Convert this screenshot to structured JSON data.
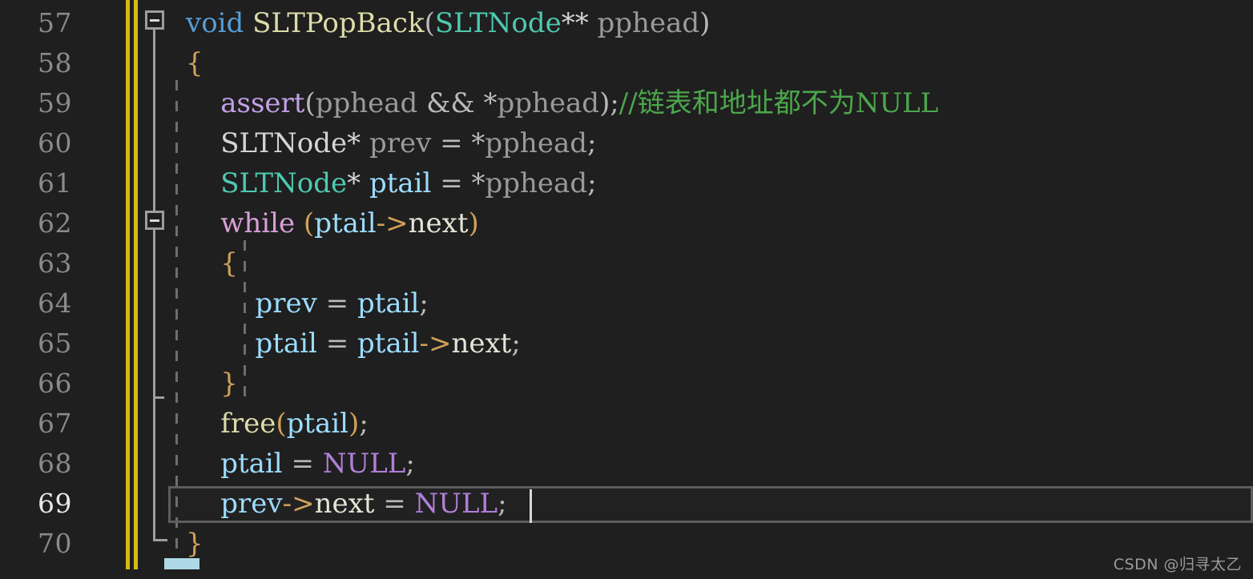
{
  "editor": {
    "background_color": "#1f1f1f",
    "current_line_number": 69,
    "change_bar_color": "#d6b915",
    "fold_guide_color": "#9d9d9d",
    "indent_guide_color": "#6e6e6e",
    "current_line_border_color": "#5d5d5d",
    "caret_color": "#d8d8d8",
    "bottom_marker_color": "#aed8e6",
    "language": "C"
  },
  "colors": {
    "keyword": "#569cd6",
    "control": "#d8a0d8",
    "function": "#dcdcaa",
    "type": "#4ec9b0",
    "variable": "#9cdcfe",
    "parameter": "#9a9a9a",
    "macro": "#c2a0e8",
    "constant": "#b07fd8",
    "punctuation": "#b9b9b9",
    "brace": "#d1a05a",
    "member": "#e4e4d6",
    "comment": "#4ca64c",
    "line_number": "#8a8a8a",
    "line_number_active": "#e8e8e8"
  },
  "gutter": {
    "line_numbers": [
      "57",
      "58",
      "59",
      "60",
      "61",
      "62",
      "63",
      "64",
      "65",
      "66",
      "67",
      "68",
      "69",
      "70"
    ]
  },
  "fold_widgets": [
    {
      "name": "fold-toggle-line-57",
      "line": "57",
      "state": "expanded",
      "glyph": "minus"
    },
    {
      "name": "fold-toggle-line-62",
      "line": "62",
      "state": "expanded",
      "glyph": "minus"
    }
  ],
  "code_lines": [
    {
      "number": "57",
      "plain": "void SLTPopBack(SLTNode** pphead)",
      "tokens": [
        {
          "text": "void",
          "cls": "t-kw"
        },
        {
          "text": " ",
          "cls": "t-punct"
        },
        {
          "text": "SLTPopBack",
          "cls": "t-fn"
        },
        {
          "text": "(",
          "cls": "t-punct"
        },
        {
          "text": "SLTNode",
          "cls": "t-type"
        },
        {
          "text": "**",
          "cls": "t-typep"
        },
        {
          "text": " ",
          "cls": "t-punct"
        },
        {
          "text": "pphead",
          "cls": "t-param"
        },
        {
          "text": ")",
          "cls": "t-punct"
        }
      ]
    },
    {
      "number": "58",
      "plain": "{",
      "tokens": [
        {
          "text": "{",
          "cls": "t-brace"
        }
      ]
    },
    {
      "number": "59",
      "plain": "    assert(pphead && *pphead);//链表和地址都不为NULL",
      "tokens": [
        {
          "text": "    ",
          "cls": "t-punct"
        },
        {
          "text": "assert",
          "cls": "t-macro"
        },
        {
          "text": "(",
          "cls": "t-punct"
        },
        {
          "text": "pphead",
          "cls": "t-param"
        },
        {
          "text": " && *",
          "cls": "t-punct"
        },
        {
          "text": "pphead",
          "cls": "t-param"
        },
        {
          "text": ");",
          "cls": "t-punct"
        },
        {
          "text": "//链表和地址都不为NULL",
          "cls": "t-comment"
        }
      ]
    },
    {
      "number": "60",
      "plain": "    SLTNode* prev = *pphead;",
      "tokens": [
        {
          "text": "    ",
          "cls": "t-punct"
        },
        {
          "text": "SLTNode",
          "cls": "t-typep"
        },
        {
          "text": "*",
          "cls": "t-typep"
        },
        {
          "text": " ",
          "cls": "t-punct"
        },
        {
          "text": "prev",
          "cls": "t-param"
        },
        {
          "text": " = *",
          "cls": "t-punct"
        },
        {
          "text": "pphead",
          "cls": "t-param"
        },
        {
          "text": ";",
          "cls": "t-punct"
        }
      ]
    },
    {
      "number": "61",
      "plain": "    SLTNode* ptail = *pphead;",
      "tokens": [
        {
          "text": "    ",
          "cls": "t-punct"
        },
        {
          "text": "SLTNode",
          "cls": "t-type"
        },
        {
          "text": "*",
          "cls": "t-typep"
        },
        {
          "text": " ",
          "cls": "t-punct"
        },
        {
          "text": "ptail",
          "cls": "t-var"
        },
        {
          "text": " = *",
          "cls": "t-punct"
        },
        {
          "text": "pphead",
          "cls": "t-param"
        },
        {
          "text": ";",
          "cls": "t-punct"
        }
      ]
    },
    {
      "number": "62",
      "plain": "    while (ptail->next)",
      "tokens": [
        {
          "text": "    ",
          "cls": "t-punct"
        },
        {
          "text": "while",
          "cls": "t-ctrl"
        },
        {
          "text": " ",
          "cls": "t-punct"
        },
        {
          "text": "(",
          "cls": "t-brace"
        },
        {
          "text": "ptail",
          "cls": "t-var"
        },
        {
          "text": "->",
          "cls": "t-brace"
        },
        {
          "text": "next",
          "cls": "t-member"
        },
        {
          "text": ")",
          "cls": "t-brace"
        }
      ]
    },
    {
      "number": "63",
      "plain": "    {",
      "tokens": [
        {
          "text": "    ",
          "cls": "t-punct"
        },
        {
          "text": "{",
          "cls": "t-brace"
        }
      ]
    },
    {
      "number": "64",
      "plain": "        prev = ptail;",
      "tokens": [
        {
          "text": "        ",
          "cls": "t-punct"
        },
        {
          "text": "prev",
          "cls": "t-var"
        },
        {
          "text": " = ",
          "cls": "t-punct"
        },
        {
          "text": "ptail",
          "cls": "t-var"
        },
        {
          "text": ";",
          "cls": "t-punct"
        }
      ]
    },
    {
      "number": "65",
      "plain": "        ptail = ptail->next;",
      "tokens": [
        {
          "text": "        ",
          "cls": "t-punct"
        },
        {
          "text": "ptail",
          "cls": "t-var"
        },
        {
          "text": " = ",
          "cls": "t-punct"
        },
        {
          "text": "ptail",
          "cls": "t-var"
        },
        {
          "text": "->",
          "cls": "t-brace"
        },
        {
          "text": "next",
          "cls": "t-member"
        },
        {
          "text": ";",
          "cls": "t-punct"
        }
      ]
    },
    {
      "number": "66",
      "plain": "    }",
      "tokens": [
        {
          "text": "    ",
          "cls": "t-punct"
        },
        {
          "text": "}",
          "cls": "t-brace"
        }
      ]
    },
    {
      "number": "67",
      "plain": "    free(ptail);",
      "tokens": [
        {
          "text": "    ",
          "cls": "t-punct"
        },
        {
          "text": "free",
          "cls": "t-fn"
        },
        {
          "text": "(",
          "cls": "t-brace"
        },
        {
          "text": "ptail",
          "cls": "t-var"
        },
        {
          "text": ")",
          "cls": "t-brace"
        },
        {
          "text": ";",
          "cls": "t-punct"
        }
      ]
    },
    {
      "number": "68",
      "plain": "    ptail = NULL;",
      "tokens": [
        {
          "text": "    ",
          "cls": "t-punct"
        },
        {
          "text": "ptail",
          "cls": "t-var"
        },
        {
          "text": " = ",
          "cls": "t-punct"
        },
        {
          "text": "NULL",
          "cls": "t-const"
        },
        {
          "text": ";",
          "cls": "t-punct"
        }
      ]
    },
    {
      "number": "69",
      "plain": "    prev->next = NULL;",
      "tokens": [
        {
          "text": "    ",
          "cls": "t-punct"
        },
        {
          "text": "prev",
          "cls": "t-var"
        },
        {
          "text": "->",
          "cls": "t-brace"
        },
        {
          "text": "next",
          "cls": "t-member"
        },
        {
          "text": " = ",
          "cls": "t-punct"
        },
        {
          "text": "NULL",
          "cls": "t-const"
        },
        {
          "text": ";",
          "cls": "t-punct"
        }
      ]
    },
    {
      "number": "70",
      "plain": "}",
      "tokens": [
        {
          "text": "}",
          "cls": "t-brace"
        }
      ]
    }
  ],
  "watermark": {
    "text": "CSDN @归寻太乙"
  }
}
